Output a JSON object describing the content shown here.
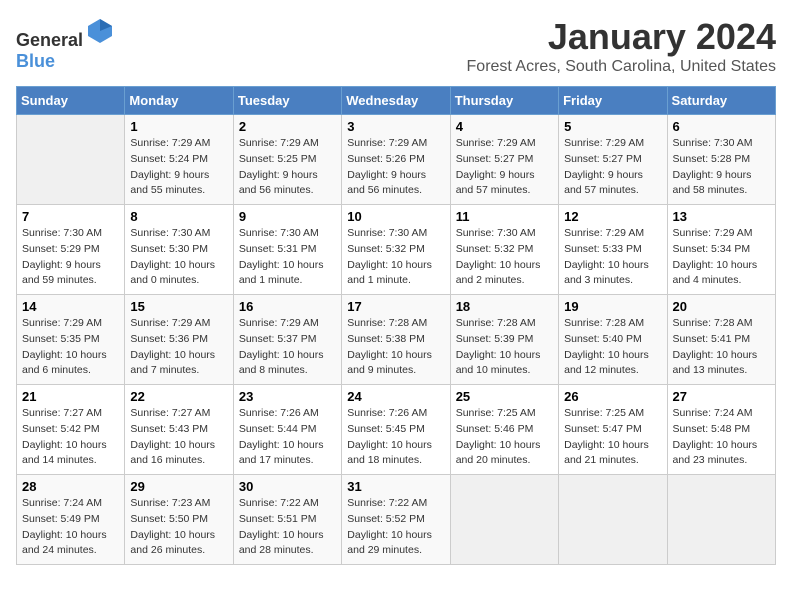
{
  "app": {
    "name_general": "General",
    "name_blue": "Blue"
  },
  "header": {
    "title": "January 2024",
    "subtitle": "Forest Acres, South Carolina, United States"
  },
  "calendar": {
    "days_of_week": [
      "Sunday",
      "Monday",
      "Tuesday",
      "Wednesday",
      "Thursday",
      "Friday",
      "Saturday"
    ],
    "weeks": [
      [
        {
          "day": "",
          "sunrise": "",
          "sunset": "",
          "daylight": ""
        },
        {
          "day": "1",
          "sunrise": "Sunrise: 7:29 AM",
          "sunset": "Sunset: 5:24 PM",
          "daylight": "Daylight: 9 hours and 55 minutes."
        },
        {
          "day": "2",
          "sunrise": "Sunrise: 7:29 AM",
          "sunset": "Sunset: 5:25 PM",
          "daylight": "Daylight: 9 hours and 56 minutes."
        },
        {
          "day": "3",
          "sunrise": "Sunrise: 7:29 AM",
          "sunset": "Sunset: 5:26 PM",
          "daylight": "Daylight: 9 hours and 56 minutes."
        },
        {
          "day": "4",
          "sunrise": "Sunrise: 7:29 AM",
          "sunset": "Sunset: 5:27 PM",
          "daylight": "Daylight: 9 hours and 57 minutes."
        },
        {
          "day": "5",
          "sunrise": "Sunrise: 7:29 AM",
          "sunset": "Sunset: 5:27 PM",
          "daylight": "Daylight: 9 hours and 57 minutes."
        },
        {
          "day": "6",
          "sunrise": "Sunrise: 7:30 AM",
          "sunset": "Sunset: 5:28 PM",
          "daylight": "Daylight: 9 hours and 58 minutes."
        }
      ],
      [
        {
          "day": "7",
          "sunrise": "Sunrise: 7:30 AM",
          "sunset": "Sunset: 5:29 PM",
          "daylight": "Daylight: 9 hours and 59 minutes."
        },
        {
          "day": "8",
          "sunrise": "Sunrise: 7:30 AM",
          "sunset": "Sunset: 5:30 PM",
          "daylight": "Daylight: 10 hours and 0 minutes."
        },
        {
          "day": "9",
          "sunrise": "Sunrise: 7:30 AM",
          "sunset": "Sunset: 5:31 PM",
          "daylight": "Daylight: 10 hours and 1 minute."
        },
        {
          "day": "10",
          "sunrise": "Sunrise: 7:30 AM",
          "sunset": "Sunset: 5:32 PM",
          "daylight": "Daylight: 10 hours and 1 minute."
        },
        {
          "day": "11",
          "sunrise": "Sunrise: 7:30 AM",
          "sunset": "Sunset: 5:32 PM",
          "daylight": "Daylight: 10 hours and 2 minutes."
        },
        {
          "day": "12",
          "sunrise": "Sunrise: 7:29 AM",
          "sunset": "Sunset: 5:33 PM",
          "daylight": "Daylight: 10 hours and 3 minutes."
        },
        {
          "day": "13",
          "sunrise": "Sunrise: 7:29 AM",
          "sunset": "Sunset: 5:34 PM",
          "daylight": "Daylight: 10 hours and 4 minutes."
        }
      ],
      [
        {
          "day": "14",
          "sunrise": "Sunrise: 7:29 AM",
          "sunset": "Sunset: 5:35 PM",
          "daylight": "Daylight: 10 hours and 6 minutes."
        },
        {
          "day": "15",
          "sunrise": "Sunrise: 7:29 AM",
          "sunset": "Sunset: 5:36 PM",
          "daylight": "Daylight: 10 hours and 7 minutes."
        },
        {
          "day": "16",
          "sunrise": "Sunrise: 7:29 AM",
          "sunset": "Sunset: 5:37 PM",
          "daylight": "Daylight: 10 hours and 8 minutes."
        },
        {
          "day": "17",
          "sunrise": "Sunrise: 7:28 AM",
          "sunset": "Sunset: 5:38 PM",
          "daylight": "Daylight: 10 hours and 9 minutes."
        },
        {
          "day": "18",
          "sunrise": "Sunrise: 7:28 AM",
          "sunset": "Sunset: 5:39 PM",
          "daylight": "Daylight: 10 hours and 10 minutes."
        },
        {
          "day": "19",
          "sunrise": "Sunrise: 7:28 AM",
          "sunset": "Sunset: 5:40 PM",
          "daylight": "Daylight: 10 hours and 12 minutes."
        },
        {
          "day": "20",
          "sunrise": "Sunrise: 7:28 AM",
          "sunset": "Sunset: 5:41 PM",
          "daylight": "Daylight: 10 hours and 13 minutes."
        }
      ],
      [
        {
          "day": "21",
          "sunrise": "Sunrise: 7:27 AM",
          "sunset": "Sunset: 5:42 PM",
          "daylight": "Daylight: 10 hours and 14 minutes."
        },
        {
          "day": "22",
          "sunrise": "Sunrise: 7:27 AM",
          "sunset": "Sunset: 5:43 PM",
          "daylight": "Daylight: 10 hours and 16 minutes."
        },
        {
          "day": "23",
          "sunrise": "Sunrise: 7:26 AM",
          "sunset": "Sunset: 5:44 PM",
          "daylight": "Daylight: 10 hours and 17 minutes."
        },
        {
          "day": "24",
          "sunrise": "Sunrise: 7:26 AM",
          "sunset": "Sunset: 5:45 PM",
          "daylight": "Daylight: 10 hours and 18 minutes."
        },
        {
          "day": "25",
          "sunrise": "Sunrise: 7:25 AM",
          "sunset": "Sunset: 5:46 PM",
          "daylight": "Daylight: 10 hours and 20 minutes."
        },
        {
          "day": "26",
          "sunrise": "Sunrise: 7:25 AM",
          "sunset": "Sunset: 5:47 PM",
          "daylight": "Daylight: 10 hours and 21 minutes."
        },
        {
          "day": "27",
          "sunrise": "Sunrise: 7:24 AM",
          "sunset": "Sunset: 5:48 PM",
          "daylight": "Daylight: 10 hours and 23 minutes."
        }
      ],
      [
        {
          "day": "28",
          "sunrise": "Sunrise: 7:24 AM",
          "sunset": "Sunset: 5:49 PM",
          "daylight": "Daylight: 10 hours and 24 minutes."
        },
        {
          "day": "29",
          "sunrise": "Sunrise: 7:23 AM",
          "sunset": "Sunset: 5:50 PM",
          "daylight": "Daylight: 10 hours and 26 minutes."
        },
        {
          "day": "30",
          "sunrise": "Sunrise: 7:22 AM",
          "sunset": "Sunset: 5:51 PM",
          "daylight": "Daylight: 10 hours and 28 minutes."
        },
        {
          "day": "31",
          "sunrise": "Sunrise: 7:22 AM",
          "sunset": "Sunset: 5:52 PM",
          "daylight": "Daylight: 10 hours and 29 minutes."
        },
        {
          "day": "",
          "sunrise": "",
          "sunset": "",
          "daylight": ""
        },
        {
          "day": "",
          "sunrise": "",
          "sunset": "",
          "daylight": ""
        },
        {
          "day": "",
          "sunrise": "",
          "sunset": "",
          "daylight": ""
        }
      ]
    ]
  }
}
